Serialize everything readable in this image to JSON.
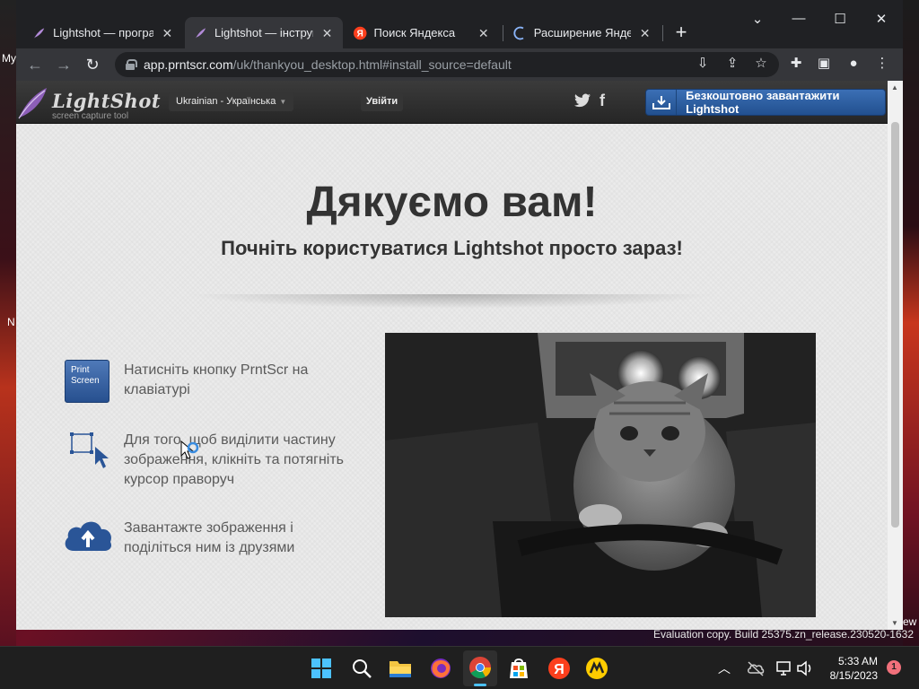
{
  "desktop": {
    "left_labels": [
      "My",
      "N"
    ],
    "right_label": "ew",
    "eval_text": "Evaluation copy. Build 25375.zn_release.230520-1632"
  },
  "browser": {
    "tabs": [
      {
        "label": "Lightshot — програм",
        "icon": "feather-icon",
        "active": false
      },
      {
        "label": "Lightshot — інструмє",
        "icon": "feather-icon",
        "active": true
      },
      {
        "label": "Поиск Яндекса",
        "icon": "yandex-icon",
        "active": false
      },
      {
        "label": "Расширение Яндекса",
        "icon": "loading-icon",
        "active": false
      }
    ],
    "new_tab": "+",
    "url_host": "app.prntscr.com",
    "url_path": "/uk/thankyou_desktop.html#install_source=default"
  },
  "site": {
    "logo_name": "LightShot",
    "logo_tag": "screen capture tool",
    "language": "Ukrainian - Українська",
    "login": "Увійти",
    "download": "Безкоштовно завантажити Lightshot",
    "hero_title": "Дякуємо вам!",
    "hero_subtitle": "Почніть користуватися Lightshot просто зараз!",
    "print_key_label_1": "Print",
    "print_key_label_2": "Screen",
    "steps": [
      {
        "text": "Натисніть кнопку PrntScr на клавіатурі"
      },
      {
        "text": "Для того, щоб виділити частину зображення, клікніть та потягніть курсор праворуч"
      },
      {
        "text": "Завантажте зображення і поділіться ним із друзями"
      }
    ]
  },
  "taskbar": {
    "time": "5:33 AM",
    "date": "8/15/2023",
    "notification_count": "1"
  },
  "colors": {
    "accent_blue": "#2a5597",
    "taskbar_bg": "#1f1f1f",
    "header_dark": "#2d2d2d"
  }
}
